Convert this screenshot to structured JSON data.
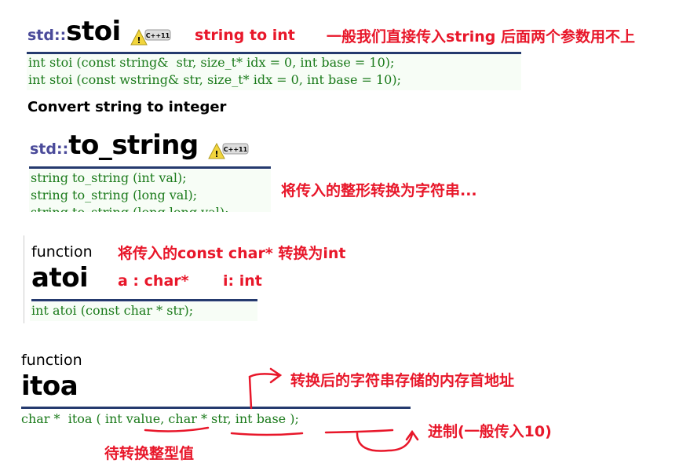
{
  "stoi": {
    "ns": "std::",
    "name": "stoi",
    "badge": "C++11",
    "code": [
      "int stoi (const string&  str, size_t* idx = 0, int base = 10);",
      "int stoi (const wstring& str, size_t* idx = 0, int base = 10);"
    ],
    "desc": "Convert string to integer",
    "note1": "string to int",
    "note2": "一般我们直接传入string 后面两个参数用不上"
  },
  "to_string": {
    "ns": "std::",
    "name": "to_string",
    "badge": "C++11",
    "code": [
      "string to_string (int val);",
      "string to_string (long val);",
      "string to_string (long long val);"
    ],
    "note": "将传入的整形转换为字符串..."
  },
  "atoi": {
    "kind": "function",
    "name": "atoi",
    "code": "int atoi (const char * str);",
    "note": "将传入的const char* 转换为int",
    "note_a": "a : char*",
    "note_i": "i: int"
  },
  "itoa": {
    "kind": "function",
    "name": "itoa",
    "code": "char *  itoa ( int value, char * str, int base );",
    "note_addr": "转换后的字符串存储的内存首地址",
    "note_base": "进制(一般传入10)",
    "note_value": "待转换整型值"
  },
  "colors": {
    "annotation": "#e8172a",
    "rule": "#253a6e",
    "code": "#1a7a1a",
    "namespace": "#4b4b9a"
  }
}
